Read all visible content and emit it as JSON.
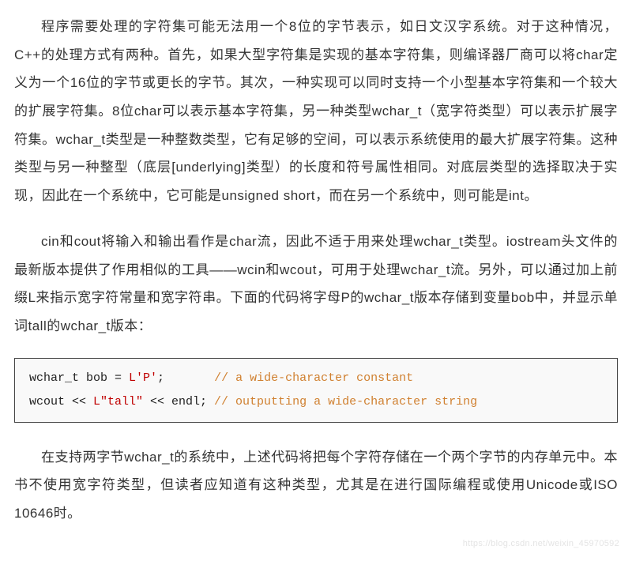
{
  "paragraphs": {
    "p1": "程序需要处理的字符集可能无法用一个8位的字节表示，如日文汉字系统。对于这种情况，C++的处理方式有两种。首先，如果大型字符集是实现的基本字符集，则编译器厂商可以将char定义为一个16位的字节或更长的字节。其次，一种实现可以同时支持一个小型基本字符集和一个较大的扩展字符集。8位char可以表示基本字符集，另一种类型wchar_t（宽字符类型）可以表示扩展字符集。wchar_t类型是一种整数类型，它有足够的空间，可以表示系统使用的最大扩展字符集。这种类型与另一种整型（底层[underlying]类型）的长度和符号属性相同。对底层类型的选择取决于实现，因此在一个系统中，它可能是unsigned short，而在另一个系统中，则可能是int。",
    "p2": "cin和cout将输入和输出看作是char流，因此不适于用来处理wchar_t类型。iostream头文件的最新版本提供了作用相似的工具——wcin和wcout，可用于处理wchar_t流。另外，可以通过加上前缀L来指示宽字符常量和宽字符串。下面的代码将字母P的wchar_t版本存储到变量bob中，并显示单词tall的wchar_t版本：",
    "p3": "在支持两字节wchar_t的系统中，上述代码将把每个字符存储在一个两个字节的内存单元中。本书不使用宽字符类型，但读者应知道有这种类型，尤其是在进行国际编程或使用Unicode或ISO 10646时。"
  },
  "code": {
    "line1_a": "wchar_t bob = ",
    "line1_lit": "L'P'",
    "line1_b": ";       ",
    "line1_comment": "// a wide-character constant",
    "line2_a": "wcout << ",
    "line2_lit": "L\"tall\"",
    "line2_b": " << endl; ",
    "line2_comment": "// outputting a wide-character string"
  },
  "watermark": "https://blog.csdn.net/weixin_45970592"
}
